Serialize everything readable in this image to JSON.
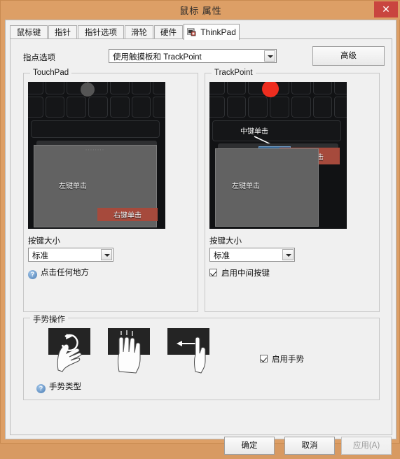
{
  "window": {
    "title": "鼠标 属性",
    "close_label": "✕"
  },
  "tabs": [
    {
      "label": "鼠标键",
      "active": false
    },
    {
      "label": "指针",
      "active": false
    },
    {
      "label": "指针选项",
      "active": false
    },
    {
      "label": "滑轮",
      "active": false
    },
    {
      "label": "硬件",
      "active": false
    },
    {
      "label": "ThinkPad",
      "active": true,
      "icon": "thinkpad-icon"
    }
  ],
  "pointing": {
    "label": "指点选项",
    "selected": "使用触摸板和 TrackPoint",
    "advanced_button": "高级"
  },
  "touchpad": {
    "group_title": "TouchPad",
    "left_click": "左键单击",
    "right_click": "右键单击",
    "button_size_label": "按键大小",
    "button_size_value": "标准",
    "help_link": "点击任何地方",
    "help_icon": "question-icon"
  },
  "trackpoint": {
    "group_title": "TrackPoint",
    "middle_click": "中键单击",
    "left_click": "左键单击",
    "right_click": "右键单击",
    "button_size_label": "按键大小",
    "button_size_value": "标准",
    "middle_button_checkbox": "启用中间按键",
    "middle_button_checked": true
  },
  "gesture": {
    "group_title": "手势操作",
    "enable_checkbox": "启用手势",
    "enable_checked": true,
    "help_link": "手势类型",
    "help_icon": "question-icon",
    "thumbnails": [
      {
        "name": "two-finger-rotate-gesture-icon"
      },
      {
        "name": "three-finger-swipe-gesture-icon"
      },
      {
        "name": "one-finger-edge-swipe-gesture-icon"
      }
    ]
  },
  "footer": {
    "ok": "确定",
    "cancel": "取消",
    "apply": "应用(A)"
  },
  "colors": {
    "titlebar": "#dd9f66",
    "close": "#c9453f",
    "accent_red": "#a64a3c",
    "trackpoint_red": "#ee2d1f",
    "middle_blue": "#3b6a97"
  }
}
